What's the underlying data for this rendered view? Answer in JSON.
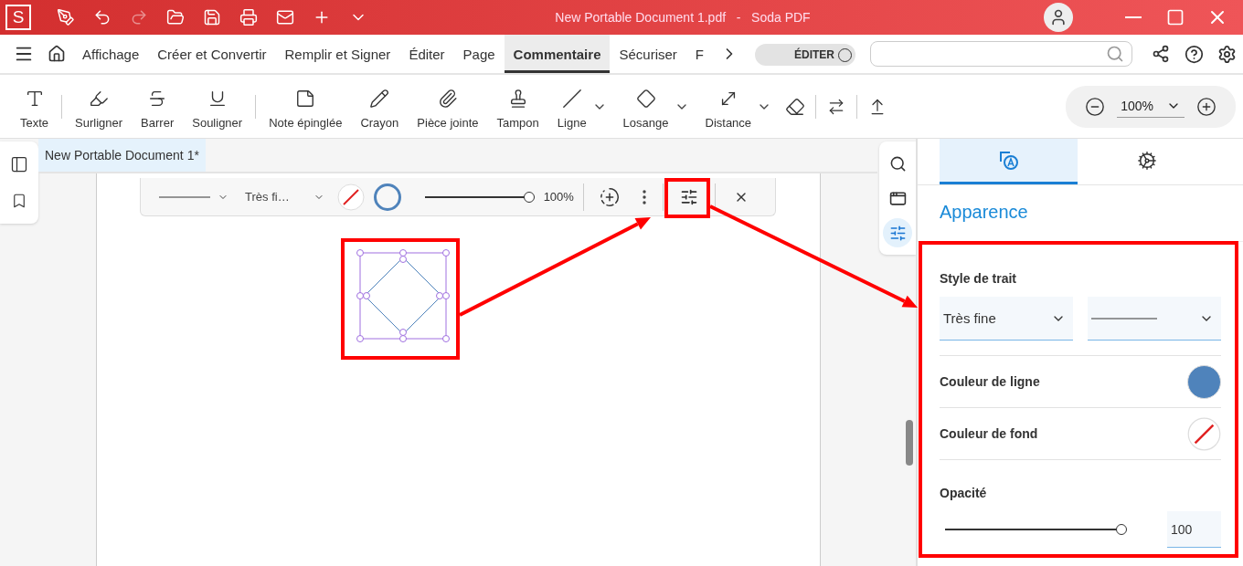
{
  "title_bar": {
    "app_letter": "S",
    "title": "New Portable Document 1.pdf   -   Soda PDF"
  },
  "menu_tabs": [
    {
      "label": "Affichage",
      "selected": false
    },
    {
      "label": "Créer et Convertir",
      "selected": false
    },
    {
      "label": "Remplir et Signer",
      "selected": false
    },
    {
      "label": "Éditer",
      "selected": false
    },
    {
      "label": "Page",
      "selected": false
    },
    {
      "label": "Commentaire",
      "selected": true
    },
    {
      "label": "Sécuriser",
      "selected": false
    },
    {
      "label": "F",
      "selected": false
    }
  ],
  "edit_toggle": {
    "label": "ÉDITER",
    "on": false
  },
  "ribbon_tools": [
    {
      "label": "Texte",
      "has_dropdown": false,
      "separator_after": true
    },
    {
      "label": "Surligner",
      "has_dropdown": false,
      "separator_after": false
    },
    {
      "label": "Barrer",
      "has_dropdown": false,
      "separator_after": false
    },
    {
      "label": "Souligner",
      "has_dropdown": false,
      "separator_after": true
    },
    {
      "label": "Note épinglée",
      "has_dropdown": false,
      "separator_after": false
    },
    {
      "label": "Crayon",
      "has_dropdown": false,
      "separator_after": false
    },
    {
      "label": "Pièce jointe",
      "has_dropdown": false,
      "separator_after": false
    },
    {
      "label": "Tampon",
      "has_dropdown": false,
      "separator_after": false
    },
    {
      "label": "Ligne",
      "has_dropdown": true,
      "separator_after": false
    },
    {
      "label": "Losange",
      "has_dropdown": true,
      "separator_after": false
    },
    {
      "label": "Distance",
      "has_dropdown": true,
      "separator_after": false
    }
  ],
  "zoom": {
    "value": "100%"
  },
  "document_tab": {
    "label": "New Portable Document 1*",
    "selected": true
  },
  "shape_toolbar": {
    "thickness": "Très fi…",
    "line_color": {
      "color": "#4f83bb"
    },
    "fill_color": {
      "no_fill": true
    },
    "opacity": {
      "level": 1,
      "reading": "100%"
    }
  },
  "panel": {
    "tabs": [
      {
        "selected": true
      },
      {
        "selected": false
      }
    ],
    "heading": "Apparence",
    "stroke_label": "Style de trait",
    "thickness": "Très fine",
    "line_color": {
      "label": "Couleur de ligne",
      "color": "#4f83bb"
    },
    "fill_color": {
      "label": "Couleur de fond",
      "no_fill": true
    },
    "opacity": {
      "label": "Opacité",
      "level": 1,
      "value": "100"
    }
  }
}
